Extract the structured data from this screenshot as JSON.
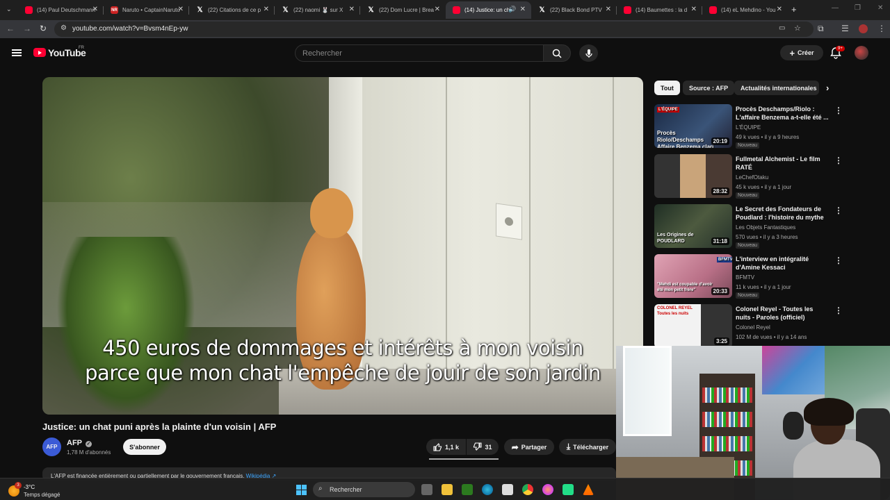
{
  "browser": {
    "tabs": [
      {
        "title": "(14) Paul Deutschmann",
        "icon": "youtube-icon",
        "active": false
      },
      {
        "title": "Naruto • CaptainNaruto",
        "icon": "naruto-icon",
        "active": false
      },
      {
        "title": "(22) Citations de ce p",
        "icon": "x-icon",
        "active": false
      },
      {
        "title": "(22) naomi 🐰 sur X",
        "icon": "x-icon",
        "active": false
      },
      {
        "title": "(22) Dom Lucre | Brea",
        "icon": "x-icon",
        "active": false
      },
      {
        "title": "(14) Justice: un ch",
        "icon": "youtube-icon",
        "active": true
      },
      {
        "title": "(22) Black Bond PTV",
        "icon": "x-icon",
        "active": false
      },
      {
        "title": "(14) Baumettes : la d",
        "icon": "youtube-icon",
        "active": false
      },
      {
        "title": "(14) eL Mehdino - You",
        "icon": "youtube-icon",
        "active": false
      }
    ],
    "new_tab": "+",
    "url": "youtube.com/watch?v=Bvsm4nEp-yw"
  },
  "youtube": {
    "logo_text": "YouTube",
    "country_code": "FR",
    "search_placeholder": "Rechercher",
    "create_label": "Créer",
    "notif_count": "9+"
  },
  "video": {
    "subtitle_line1": "450 euros de dommages et intérêts à mon voisin",
    "subtitle_line2": "parce que mon chat l'empêche de jouir de son jardin",
    "title": "Justice: un chat puni après la plainte d'un voisin | AFP",
    "channel_initials": "AFP",
    "channel": "AFP",
    "subscribers": "1,78 M d'abonnés",
    "subscribe_label": "S'abonner",
    "likes": "1,1 k",
    "dislikes": "31",
    "share_label": "Partager",
    "download_label": "Télécharger",
    "description": "L'AFP est financée entièrement ou partiellement par le gouvernement français.",
    "description_link": "Wikipédia ↗"
  },
  "sidebar": {
    "chips": [
      "Tout",
      "Source : AFP",
      "Actualités internationales"
    ],
    "recommendations": [
      {
        "title": "Procès Deschamps/Riolo : L'affaire Benzema a-t-elle été ...",
        "channel": "L'ÉQUIPE",
        "meta": "49 k vues • il y a 9 heures",
        "badge": "Nouveau",
        "duration": "20:19",
        "thumb_text": "Procès Riolo/Deschamps Affaire Benzema clari",
        "thumb_brand": "L'ÉQUIPE",
        "thumb_color": "#23324a"
      },
      {
        "title": "Fullmetal Alchemist - Le film RATÉ",
        "channel": "LeChefOtaku",
        "meta": "45 k vues • il y a 1 jour",
        "badge": "Nouveau",
        "duration": "28:32",
        "thumb_text": "",
        "thumb_brand": "",
        "thumb_color": "#5a4a45"
      },
      {
        "title": "Le Secret des Fondateurs de Poudlard : l'histoire du mythe ...",
        "channel": "Les Objets Fantastiques",
        "meta": "570 vues • il y a 3 heures",
        "badge": "Nouveau",
        "duration": "31:18",
        "thumb_text": "Les Origines de POUDLARD",
        "thumb_brand": "",
        "thumb_color": "#2c3d2f"
      },
      {
        "title": "L'interview en intégralité d'Amine Kessaci",
        "channel": "BFMTV",
        "meta": "11 k vues • il y a 1 jour",
        "badge": "Nouveau",
        "duration": "20:33",
        "thumb_text": "\"Mehdi est coupable d'avoir été mon petit frère\"",
        "thumb_brand": "BFMTV",
        "thumb_color": "#c97b8e"
      },
      {
        "title": "Colonel Reyel - Toutes les nuits - Paroles (officiel)",
        "channel": "Colonel Reyel",
        "meta": "102 M de vues • il y a 14 ans",
        "badge": "",
        "duration": "3:25",
        "thumb_text": "COLONEL REYEL Toutes les nuits",
        "thumb_brand": "",
        "thumb_color": "#eaeaea"
      }
    ]
  },
  "taskbar": {
    "weather_badge": "3",
    "temperature": "-3°C",
    "weather_desc": "Temps dégagé",
    "search_placeholder": "Rechercher"
  }
}
